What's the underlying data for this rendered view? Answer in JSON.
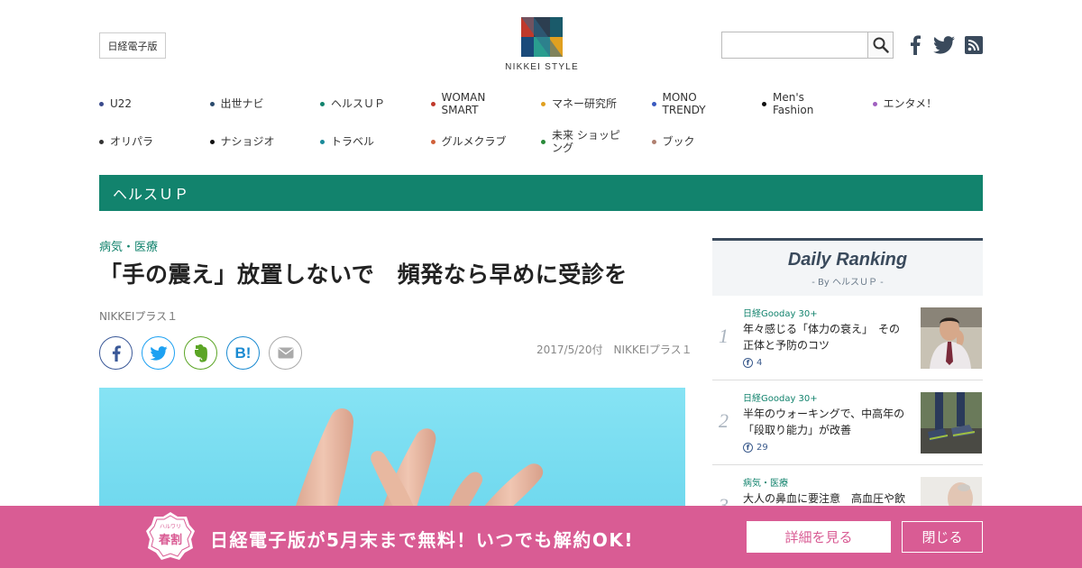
{
  "header": {
    "nikkei_button": "日経電子版",
    "logo_text": "NIKKEI STYLE",
    "search": {
      "value": "",
      "placeholder": ""
    }
  },
  "nav": {
    "rows": [
      [
        {
          "label": "U22",
          "color": "#3a4a8c"
        },
        {
          "label": "出世ナビ",
          "color": "#2a4a6c"
        },
        {
          "label": "ヘルスＵＰ",
          "color": "#12836d"
        },
        {
          "label": "WOMAN SMART",
          "color": "#c0392b"
        },
        {
          "label": "マネー研究所",
          "color": "#e0a020"
        },
        {
          "label": "MONO TRENDY",
          "color": "#3a5abf"
        },
        {
          "label": "Men's Fashion",
          "color": "#111111"
        },
        {
          "label": "エンタメ！",
          "color": "#a060c0"
        }
      ],
      [
        {
          "label": "オリパラ",
          "color": "#333333"
        },
        {
          "label": "ナショジオ",
          "color": "#111111"
        },
        {
          "label": "トラベル",
          "color": "#1a8a9a"
        },
        {
          "label": "グルメクラブ",
          "color": "#d0603a"
        },
        {
          "label": "未来 ショッピング",
          "color": "#2a8a3a"
        },
        {
          "label": "ブック",
          "color": "#b08070"
        }
      ]
    ]
  },
  "section": {
    "title": "ヘルスＵＰ"
  },
  "article": {
    "category": "病気・医療",
    "headline": "「手の震え」放置しないで　頻発なら早めに受診を",
    "source": "NIKKEIプラス１",
    "date_meta": "2017/5/20付　NIKKEIプラス１"
  },
  "share": {
    "icons": [
      "facebook-icon",
      "twitter-icon",
      "evernote-icon",
      "hatena-bookmark-icon",
      "mail-icon"
    ]
  },
  "ranking": {
    "title": "Daily Ranking",
    "by": "- By ヘルスＵＰ -",
    "items": [
      {
        "num": "1",
        "category": "日経Gooday 30+",
        "text": "年々感じる「体力の衰え」　その正体と予防のコツ",
        "count": "4"
      },
      {
        "num": "2",
        "category": "日経Gooday 30+",
        "text": "半年のウォーキングで、中高年の「段取り能力」が改善",
        "count": "29"
      },
      {
        "num": "3",
        "category": "病気・医療",
        "text": "大人の鼻血に要注意　高血圧や飲",
        "count": ""
      }
    ]
  },
  "promo": {
    "badge_main": "春割",
    "badge_sub": "ハルワリ",
    "text": "日経電子版が5月末まで無料！いつでも解約OK!",
    "detail_button": "詳細を見る",
    "close_button": "閉じる",
    "color": "#d95c94"
  },
  "colors": {
    "accent": "#12836d",
    "ranking_dark": "#3a4a5c"
  }
}
